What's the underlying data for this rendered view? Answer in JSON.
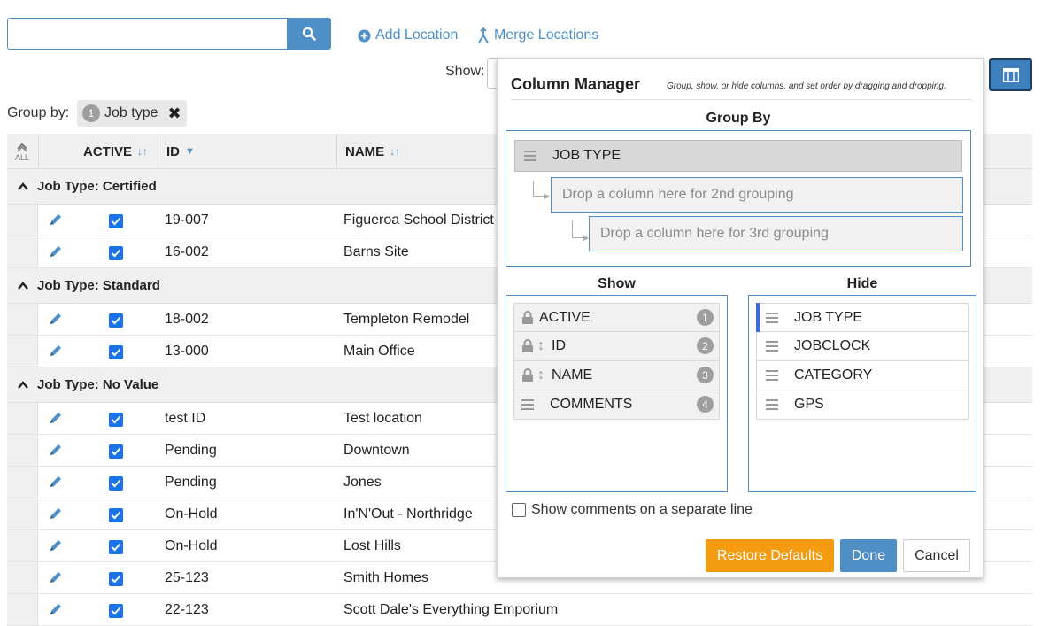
{
  "toolbar": {
    "search_value": "",
    "add_location_label": "Add Location",
    "merge_locations_label": "Merge Locations",
    "show_label": "Show:"
  },
  "group_by": {
    "label": "Group by:",
    "chip_number": "1",
    "chip_label": "Job type"
  },
  "grid": {
    "all_label": "ALL",
    "columns": [
      {
        "label": "ACTIVE"
      },
      {
        "label": "ID"
      },
      {
        "label": "NAME"
      }
    ],
    "groups": [
      {
        "title": "Job Type: Certified",
        "rows": [
          {
            "id": "19-007",
            "name": "Figueroa School District"
          },
          {
            "id": "16-002",
            "name": "Barns Site"
          }
        ]
      },
      {
        "title": "Job Type: Standard",
        "rows": [
          {
            "id": "18-002",
            "name": "Templeton Remodel"
          },
          {
            "id": "13-000",
            "name": "Main Office"
          }
        ]
      },
      {
        "title": "Job Type: No Value",
        "rows": [
          {
            "id": "test ID",
            "name": "Test location"
          },
          {
            "id": "Pending",
            "name": "Downtown"
          },
          {
            "id": "Pending",
            "name": "Jones"
          },
          {
            "id": "On-Hold",
            "name": "In'N'Out - Northridge"
          },
          {
            "id": "On-Hold",
            "name": "Lost Hills"
          },
          {
            "id": "25-123",
            "name": "Smith Homes"
          },
          {
            "id": "22-123",
            "name": "Scott Dale's Everything Emporium"
          }
        ]
      }
    ]
  },
  "column_manager": {
    "title": "Column Manager",
    "subtitle": "Group, show, or hide columns, and set order by dragging and dropping.",
    "group_by_title": "Group By",
    "group_by_item": "JOB TYPE",
    "drop_2nd": "Drop a column here for 2nd grouping",
    "drop_3rd": "Drop a column here for 3rd grouping",
    "show_title": "Show",
    "hide_title": "Hide",
    "show_items": [
      {
        "label": "ACTIVE",
        "order": "1"
      },
      {
        "label": "ID",
        "order": "2"
      },
      {
        "label": "NAME",
        "order": "3"
      },
      {
        "label": "COMMENTS",
        "order": "4"
      }
    ],
    "hide_items": [
      {
        "label": "JOB TYPE"
      },
      {
        "label": "JOBCLOCK"
      },
      {
        "label": "CATEGORY"
      },
      {
        "label": "GPS"
      }
    ],
    "separate_line_label": "Show comments on a separate line",
    "restore_label": "Restore Defaults",
    "done_label": "Done",
    "cancel_label": "Cancel"
  },
  "colors": {
    "accent": "#4e8fc8",
    "restore": "#f39c12",
    "checkbox": "#1a73e8"
  }
}
